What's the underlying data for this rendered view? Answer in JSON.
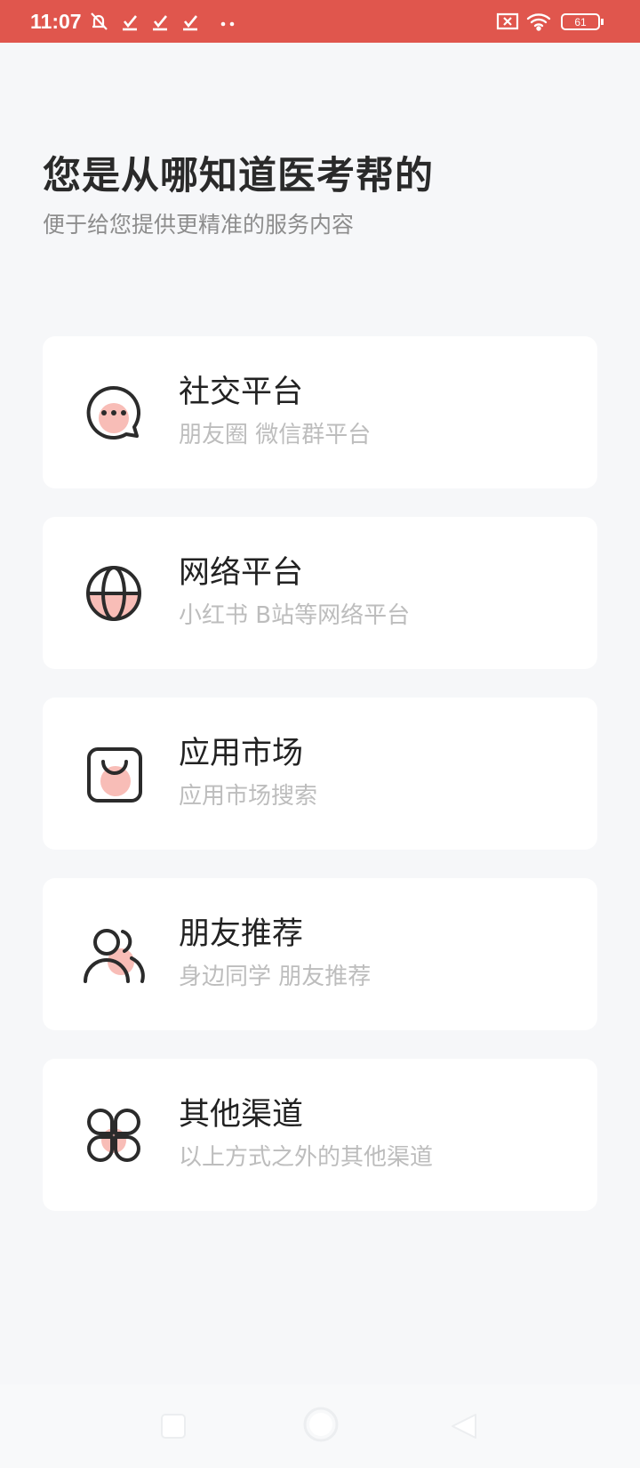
{
  "status_bar": {
    "time": "11:07",
    "battery_level": "61",
    "icons": [
      "notification-off-icon",
      "check-icon",
      "check-icon",
      "check-icon",
      "more-dots-icon",
      "no-sim-icon",
      "wifi-icon",
      "battery-icon"
    ]
  },
  "header": {
    "title": "您是从哪知道医考帮的",
    "subtitle": "便于给您提供更精准的服务内容"
  },
  "options": [
    {
      "title": "社交平台",
      "description": "朋友圈 微信群平台",
      "icon": "chat-bubble-icon"
    },
    {
      "title": "网络平台",
      "description": "小红书 B站等网络平台",
      "icon": "globe-icon"
    },
    {
      "title": "应用市场",
      "description": "应用市场搜索",
      "icon": "shopping-bag-icon"
    },
    {
      "title": "朋友推荐",
      "description": "身边同学 朋友推荐",
      "icon": "people-icon"
    },
    {
      "title": "其他渠道",
      "description": "以上方式之外的其他渠道",
      "icon": "grid-clover-icon"
    }
  ],
  "colors": {
    "accent": "#e0564d",
    "icon_fill": "#f7b1aa",
    "background": "#f6f7f9"
  },
  "nav_bar": {
    "buttons": [
      "home-square-button",
      "circle-back-button",
      "triangle-recent-button"
    ]
  }
}
